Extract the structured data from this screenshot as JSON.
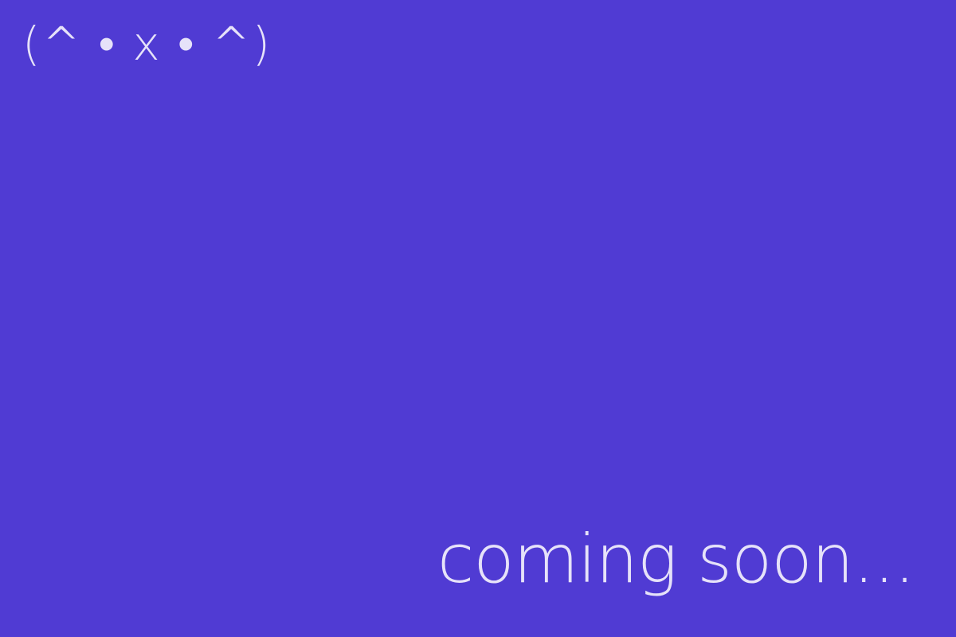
{
  "brand": {
    "logo_text": "(^ • x • ^)"
  },
  "main": {
    "message": "coming soon..."
  },
  "colors": {
    "background": "#503bd3",
    "text": "#e6e2f9"
  }
}
